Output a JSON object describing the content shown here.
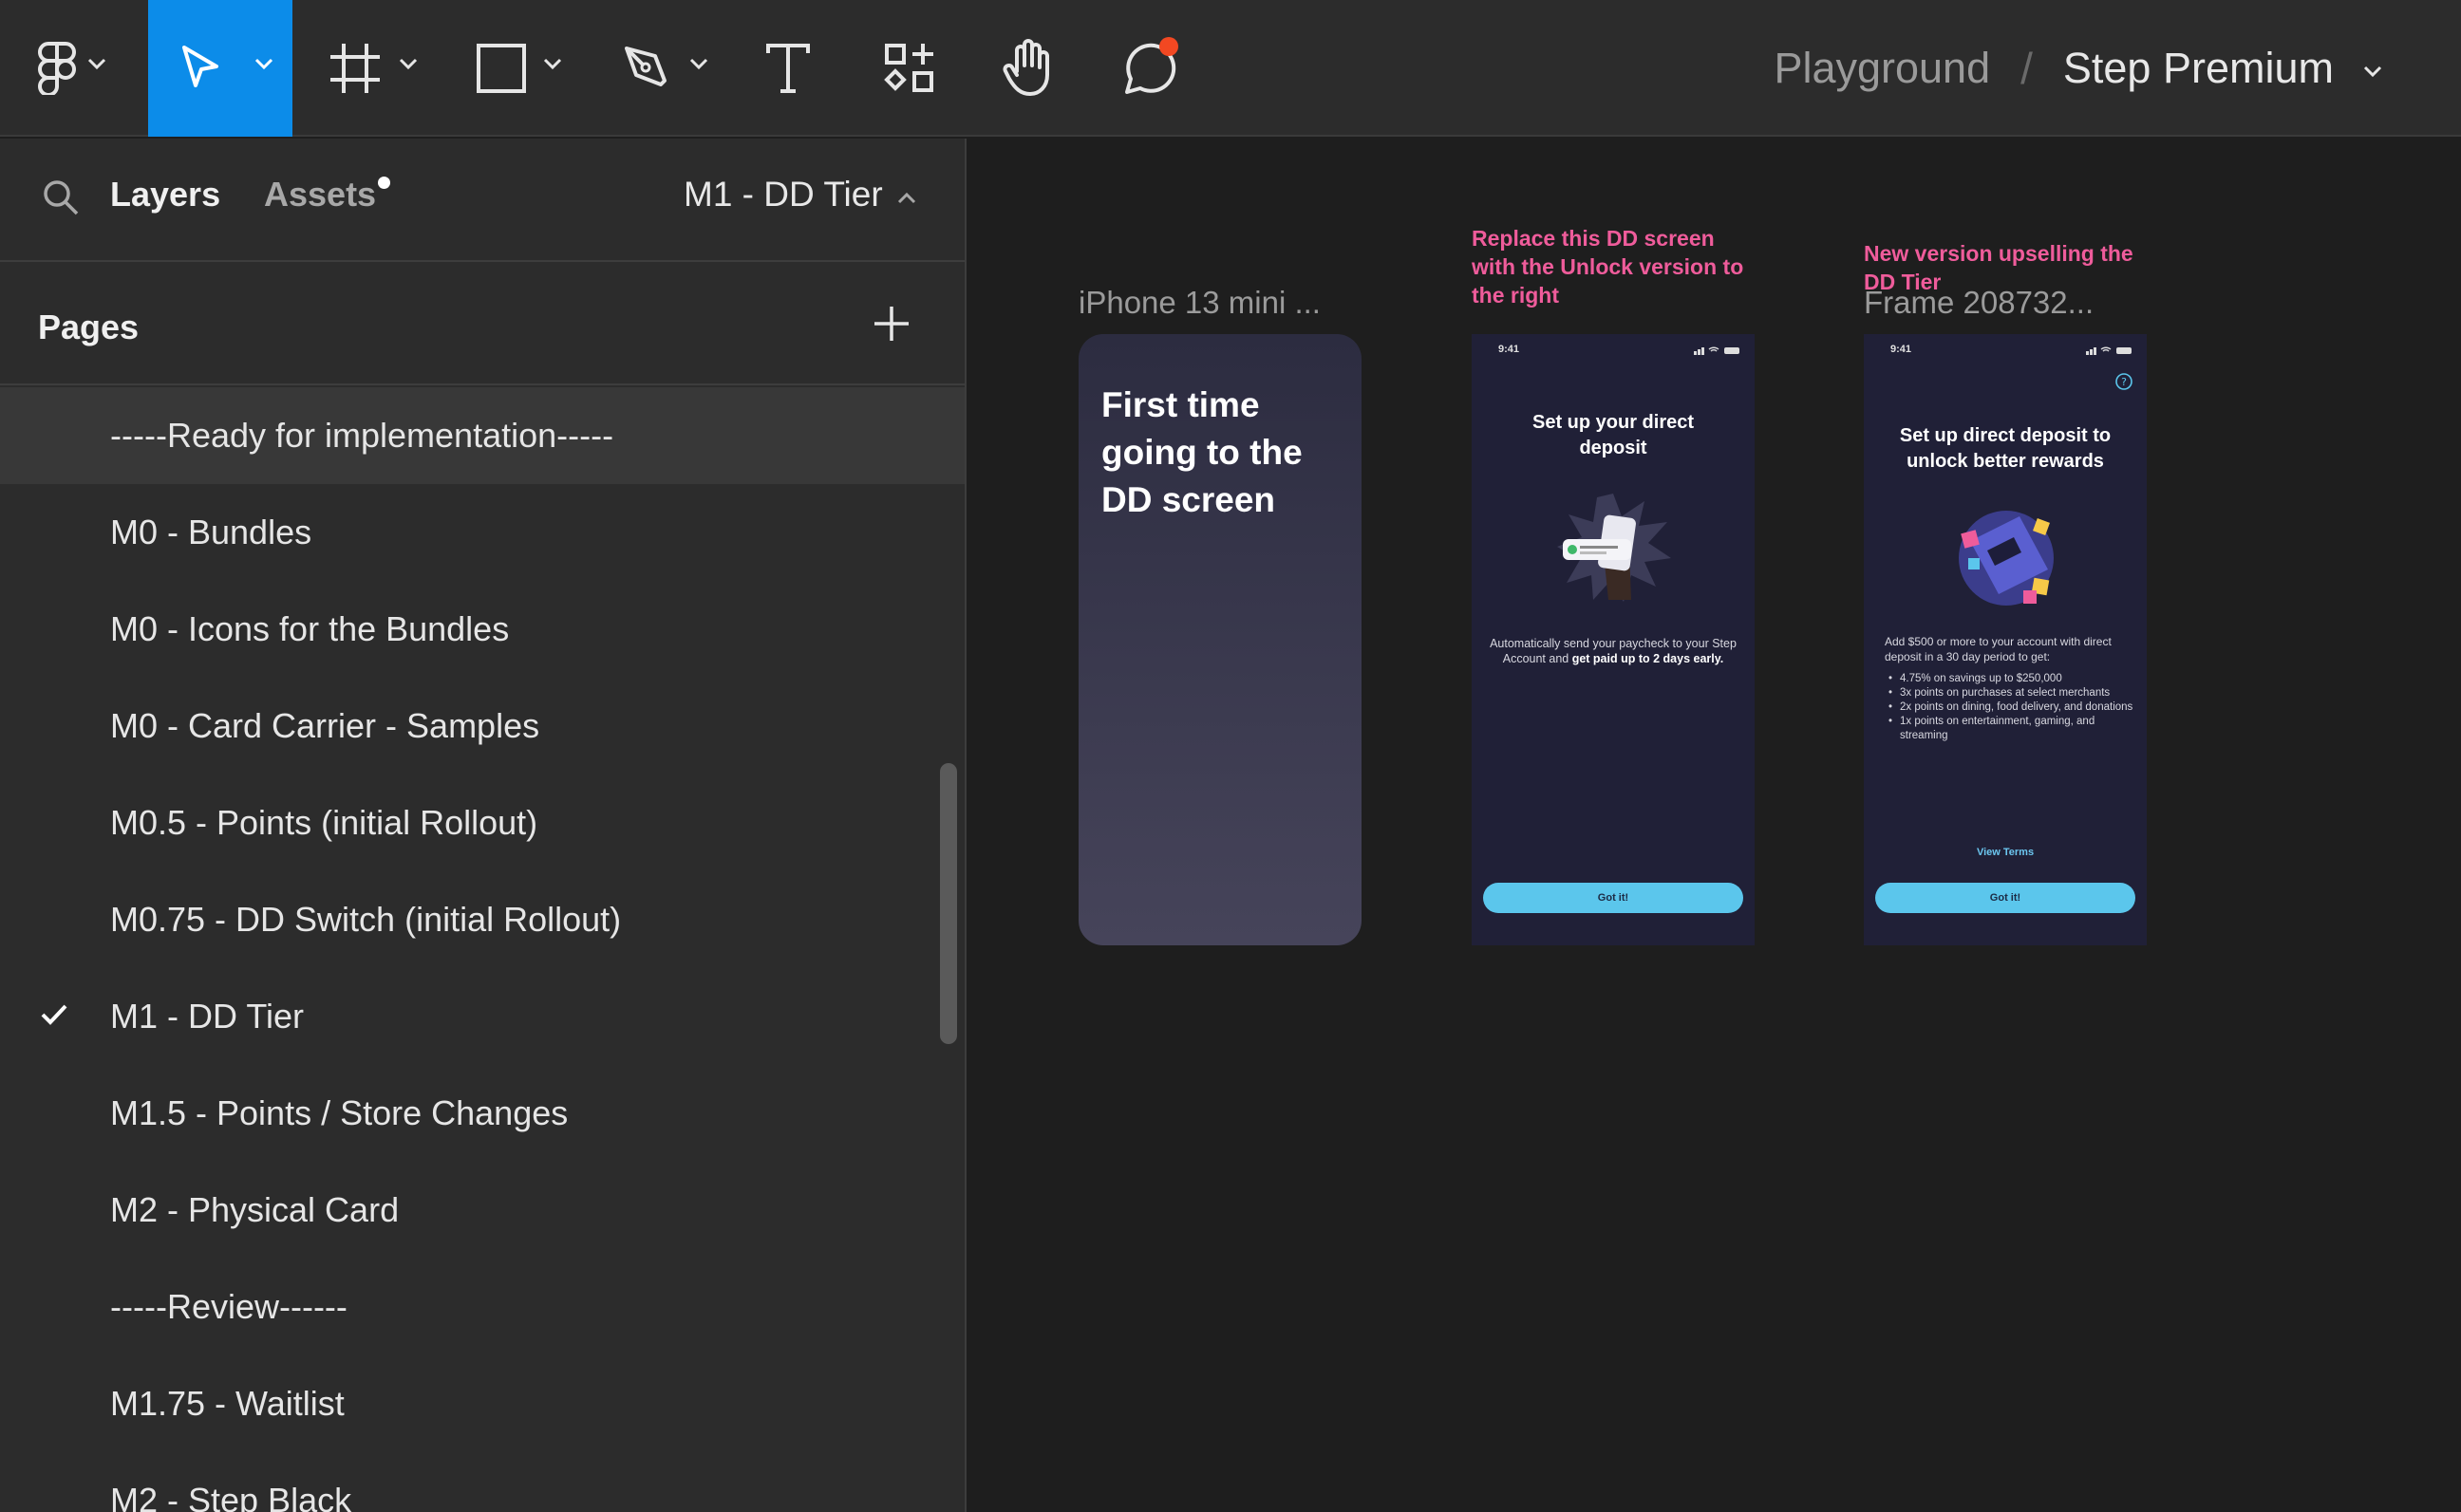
{
  "toolbar": {
    "tools": [
      {
        "name": "main-menu",
        "icon": "figma-logo-icon"
      },
      {
        "name": "move",
        "icon": "move-cursor-icon",
        "active": true
      },
      {
        "name": "frame",
        "icon": "frame-hash-icon"
      },
      {
        "name": "rectangle",
        "icon": "rectangle-icon"
      },
      {
        "name": "pen",
        "icon": "pen-icon"
      },
      {
        "name": "text",
        "icon": "text-t-icon"
      },
      {
        "name": "resources",
        "icon": "resources-icon"
      },
      {
        "name": "hand",
        "icon": "hand-icon"
      },
      {
        "name": "comment",
        "icon": "comment-icon",
        "badge_color": "#f24822"
      }
    ],
    "accent_color": "#0c8ce9"
  },
  "breadcrumb": {
    "file": "Playground",
    "separator": "/",
    "page": "Step Premium"
  },
  "left_panel": {
    "tabs": {
      "layers": "Layers",
      "assets": "Assets"
    },
    "current_page": "M1 - DD Tier",
    "pages_title": "Pages",
    "pages": [
      {
        "label": "-----Ready for implementation-----",
        "highlighted": true
      },
      {
        "label": "M0 - Bundles"
      },
      {
        "label": "M0 - Icons for the Bundles"
      },
      {
        "label": "M0 - Card Carrier - Samples"
      },
      {
        "label": "M0.5 - Points (initial Rollout)"
      },
      {
        "label": "M0.75 - DD Switch (initial Rollout)"
      },
      {
        "label": "M1 - DD Tier",
        "selected": true
      },
      {
        "label": "M1.5 - Points / Store Changes"
      },
      {
        "label": "M2 - Physical Card"
      },
      {
        "label": "-----Review------"
      },
      {
        "label": "M1.75 - Waitlist"
      },
      {
        "label": "M2 - Step Black"
      }
    ]
  },
  "canvas": {
    "frames": [
      {
        "label": "iPhone 13 mini ...",
        "text": "First time going to the DD screen"
      },
      {
        "note": "Replace this DD screen with the Unlock version to the right",
        "status_time": "9:41",
        "title": "Set up your direct deposit",
        "body_prefix": "Automatically send your paycheck to your Step Account and ",
        "body_bold": "get paid up to 2 days early.",
        "button": "Got it!"
      },
      {
        "note": "New version upselling the DD Tier",
        "label": "Frame 208732...",
        "status_time": "9:41",
        "title": "Set up direct deposit to unlock better rewards",
        "intro": "Add $500 or more to your account with direct deposit in a 30 day period to get:",
        "bullets": [
          "4.75% on savings up to $250,000",
          "3x points on purchases at select merchants",
          "2x points on dining, food delivery, and donations",
          "1x points on entertainment, gaming, and streaming"
        ],
        "link": "View Terms",
        "button": "Got it!"
      }
    ],
    "note_color": "#ef5c9b"
  }
}
